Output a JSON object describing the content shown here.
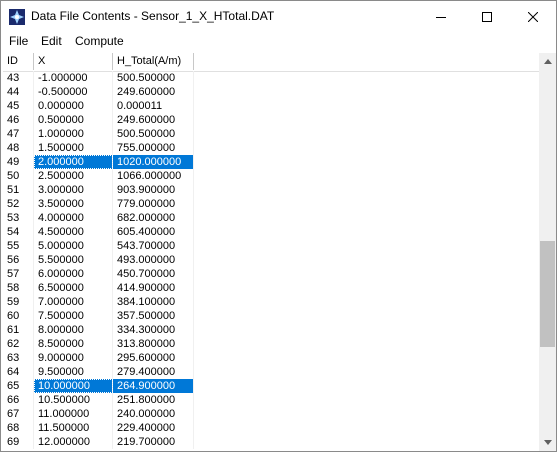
{
  "window": {
    "title": "Data File Contents - Sensor_1_X_HTotal.DAT",
    "icon": "app-icon",
    "controls": [
      "minimize-icon",
      "maximize-icon",
      "close-icon"
    ]
  },
  "menu": {
    "file": "File",
    "edit": "Edit",
    "compute": "Compute"
  },
  "table": {
    "columns": [
      "ID",
      "X",
      "H_Total(A/m)"
    ],
    "rows": [
      {
        "id": "43",
        "x": "-1.000000",
        "h": "500.500000",
        "selected": false
      },
      {
        "id": "44",
        "x": "-0.500000",
        "h": "249.600000",
        "selected": false
      },
      {
        "id": "45",
        "x": "0.000000",
        "h": "0.000011",
        "selected": false
      },
      {
        "id": "46",
        "x": "0.500000",
        "h": "249.600000",
        "selected": false
      },
      {
        "id": "47",
        "x": "1.000000",
        "h": "500.500000",
        "selected": false
      },
      {
        "id": "48",
        "x": "1.500000",
        "h": "755.000000",
        "selected": false
      },
      {
        "id": "49",
        "x": "2.000000",
        "h": "1020.000000",
        "selected": true
      },
      {
        "id": "50",
        "x": "2.500000",
        "h": "1066.000000",
        "selected": false
      },
      {
        "id": "51",
        "x": "3.000000",
        "h": "903.900000",
        "selected": false
      },
      {
        "id": "52",
        "x": "3.500000",
        "h": "779.000000",
        "selected": false
      },
      {
        "id": "53",
        "x": "4.000000",
        "h": "682.000000",
        "selected": false
      },
      {
        "id": "54",
        "x": "4.500000",
        "h": "605.400000",
        "selected": false
      },
      {
        "id": "55",
        "x": "5.000000",
        "h": "543.700000",
        "selected": false
      },
      {
        "id": "56",
        "x": "5.500000",
        "h": "493.000000",
        "selected": false
      },
      {
        "id": "57",
        "x": "6.000000",
        "h": "450.700000",
        "selected": false
      },
      {
        "id": "58",
        "x": "6.500000",
        "h": "414.900000",
        "selected": false
      },
      {
        "id": "59",
        "x": "7.000000",
        "h": "384.100000",
        "selected": false
      },
      {
        "id": "60",
        "x": "7.500000",
        "h": "357.500000",
        "selected": false
      },
      {
        "id": "61",
        "x": "8.000000",
        "h": "334.300000",
        "selected": false
      },
      {
        "id": "62",
        "x": "8.500000",
        "h": "313.800000",
        "selected": false
      },
      {
        "id": "63",
        "x": "9.000000",
        "h": "295.600000",
        "selected": false
      },
      {
        "id": "64",
        "x": "9.500000",
        "h": "279.400000",
        "selected": false
      },
      {
        "id": "65",
        "x": "10.000000",
        "h": "264.900000",
        "selected": true
      },
      {
        "id": "66",
        "x": "10.500000",
        "h": "251.800000",
        "selected": false
      },
      {
        "id": "67",
        "x": "11.000000",
        "h": "240.000000",
        "selected": false
      },
      {
        "id": "68",
        "x": "11.500000",
        "h": "229.400000",
        "selected": false
      },
      {
        "id": "69",
        "x": "12.000000",
        "h": "219.700000",
        "selected": false
      }
    ]
  },
  "colors": {
    "selection": "#0078d7",
    "scroll_thumb": "#c1c1c1"
  }
}
